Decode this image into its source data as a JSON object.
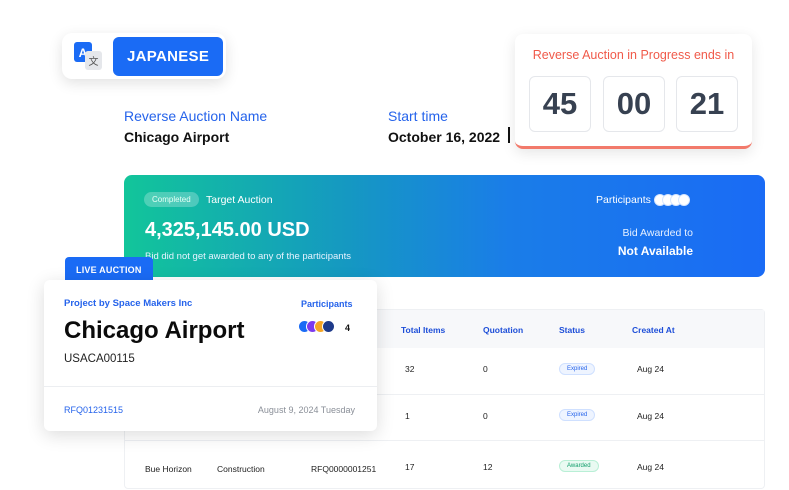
{
  "language": {
    "label": "JAPANESE",
    "icon": "translate-icon"
  },
  "auction": {
    "name_label": "Reverse Auction Name",
    "name": "Chicago Airport",
    "start_label": "Start time",
    "start": "October 16, 2022"
  },
  "countdown": {
    "title": "Reverse Auction in Progress ends in",
    "hours": "45",
    "minutes": "00",
    "seconds": "21"
  },
  "banner": {
    "badge": "Completed",
    "target_label": "Target Auction",
    "amount": "4,325,145.00 USD",
    "sub": "Bid did not get awarded to any of the participants",
    "participants_label": "Participants",
    "awarded_label": "Bid Awarded to",
    "awarded_value": "Not Available"
  },
  "table": {
    "headers": [
      "Total Items",
      "Quotation",
      "Status",
      "Created At"
    ],
    "rows": [
      {
        "total": "32",
        "quotation": "0",
        "status": "Expired",
        "created": "Aug 24"
      },
      {
        "total": "1",
        "quotation": "0",
        "status": "Expired",
        "created": "Aug 24"
      },
      {
        "name": "Bue Horizon",
        "category": "Construction",
        "rfq": "RFQ0000001251",
        "total": "17",
        "quotation": "12",
        "status": "Awarded",
        "created": "Aug 24"
      }
    ]
  },
  "live_card": {
    "tab": "LIVE AUCTION",
    "project": "Project by Space Makers Inc",
    "participants_label": "Participants",
    "participants_count": "4",
    "title": "Chicago Airport",
    "code": "USACA00115",
    "rfq": "RFQ01231515",
    "date": "August 9, 2024 Tuesday"
  },
  "colors": {
    "primary": "#1a6bf5",
    "countdown_accent": "#f05a4a",
    "banner_start": "#12c59a",
    "dot_colors": [
      "#1a6bf5",
      "#7c3aed",
      "#f5a524",
      "#1e3a8a"
    ]
  }
}
